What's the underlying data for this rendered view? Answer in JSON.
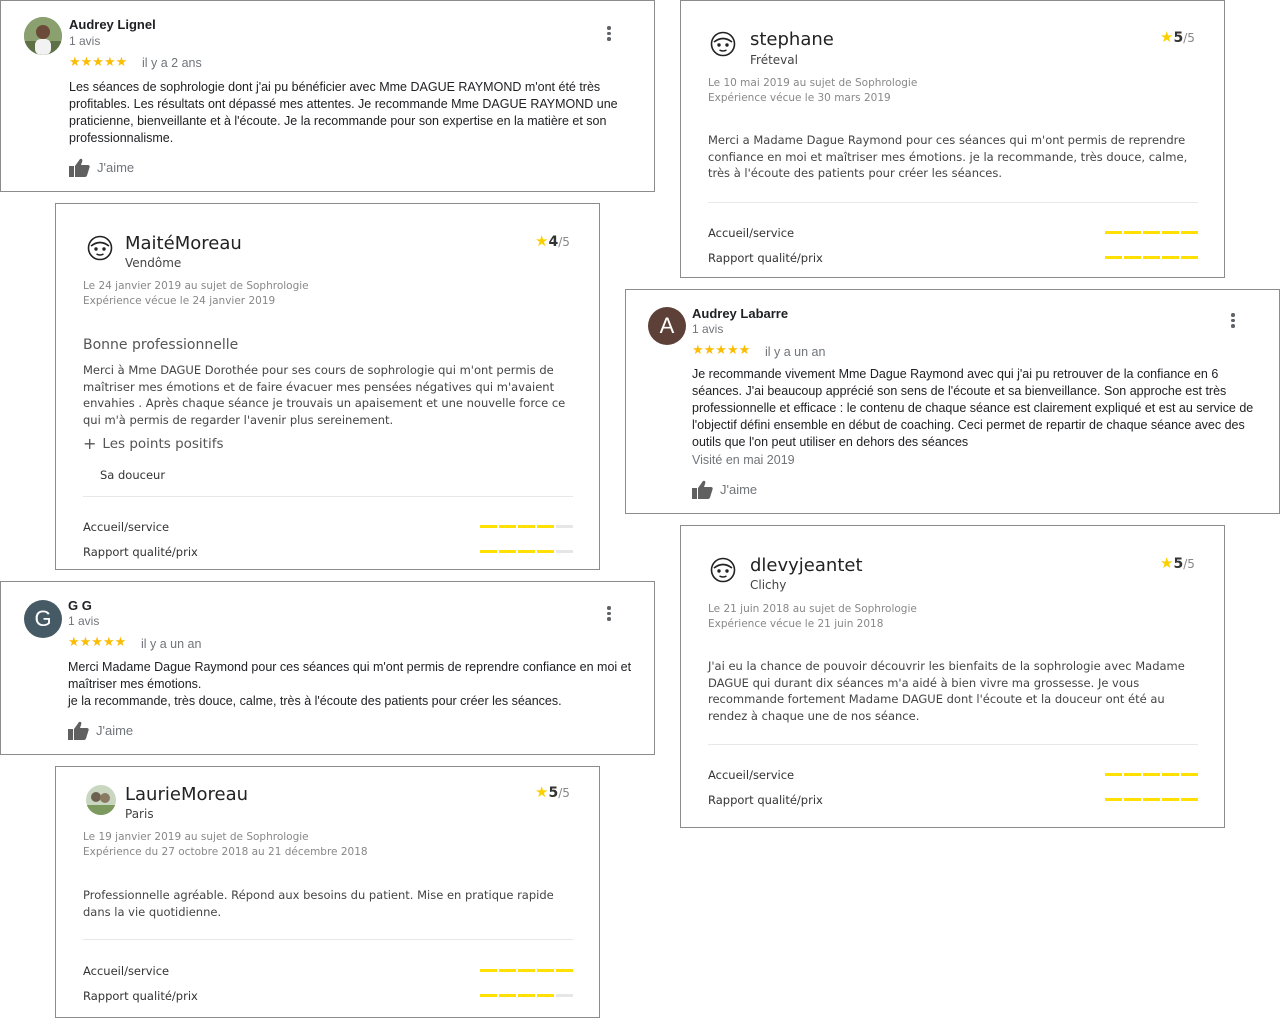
{
  "colors": {
    "star": "#fbbc04",
    "bar_on": "#ffe000",
    "bar_off": "#e6e6e6",
    "avatar_a": "#5d4037",
    "avatar_g": "#455a64"
  },
  "icons": {
    "like": "thumb-up-icon",
    "menu": "more-vert-icon",
    "anon": "anonymous-face-icon"
  },
  "google_reviews": [
    {
      "name": "Audrey Lignel",
      "count": "1 avis",
      "stars": "★★★★★",
      "date": "il y a 2 ans",
      "text": "Les séances de sophrologie dont j'ai pu bénéficier avec Mme  DAGUE RAYMOND m'ont été très profitables. Les résultats ont dépassé mes attentes. Je recommande Mme DAGUE RAYMOND une praticienne, bienveillante et à l'écoute. Je la recommande pour son expertise en la matière et son professionnalisme.",
      "like": "J'aime"
    },
    {
      "name": "Audrey Labarre",
      "initial": "A",
      "count": "1 avis",
      "stars": "★★★★★",
      "date": "il y a un an",
      "text": "Je recommande vivement Mme Dague Raymond avec qui j'ai pu retrouver de la confiance en 6 séances. J'ai beaucoup apprécié son sens de l'écoute et sa bienveillance. Son approche est très professionnelle et efficace : le contenu de chaque séance est clairement expliqué et est au service de l'objectif défini ensemble en début de coaching. Ceci permet de repartir de chaque séance avec des outils que l'on peut utiliser en dehors des séances",
      "visit": "Visité en mai 2019",
      "like": "J'aime"
    },
    {
      "name": "G G",
      "initial": "G",
      "count": "1 avis",
      "stars": "★★★★★",
      "date": "il y a un an",
      "text": "Merci Madame Dague Raymond pour ces séances qui m'ont permis de reprendre confiance en moi et maîtriser mes émotions.\nje la recommande, très douce, calme, très à l'écoute des patients pour créer les séances.",
      "like": "J'aime"
    }
  ],
  "pj_reviews": [
    {
      "name": "stephane",
      "city": "Fréteval",
      "rating": "5",
      "rating_total": "/5",
      "meta1": "Le 10 mai 2019 au sujet de Sophrologie",
      "meta2": "Expérience vécue le 30 mars 2019",
      "text": "Merci a Madame Dague Raymond pour ces séances qui m'ont permis de reprendre confiance en moi et maîtriser mes émotions. je la recommande, très douce, calme, très à l'écoute des patients pour créer les séances.",
      "accueil_label": "Accueil/service",
      "accueil_score": 5,
      "rapport_label": "Rapport qualité/prix",
      "rapport_score": 5
    },
    {
      "name": "MaitéMoreau",
      "city": "Vendôme",
      "rating": "4",
      "rating_total": "/5",
      "meta1": "Le 24 janvier 2019 au sujet de Sophrologie",
      "meta2": "Expérience vécue le 24 janvier 2019",
      "title": "Bonne professionnelle",
      "text": "Merci à Mme DAGUE Dorothée pour ses cours de sophrologie qui m'ont permis de maîtriser mes émotions et de faire évacuer mes pensées négatives qui m'avaient envahies . Après chaque séance je trouvais un apaisement et une nouvelle force ce qui m'à permis de regarder l'avenir plus sereinement.",
      "positives_label": "Les points positifs",
      "positives_text": "Sa douceur",
      "accueil_label": "Accueil/service",
      "accueil_score": 4,
      "rapport_label": "Rapport qualité/prix",
      "rapport_score": 4
    },
    {
      "name": "dlevyjeantet",
      "city": "Clichy",
      "rating": "5",
      "rating_total": "/5",
      "meta1": "Le 21 juin 2018 au sujet de Sophrologie",
      "meta2": "Expérience vécue le 21 juin 2018",
      "text": "J'ai eu la chance de pouvoir découvrir les bienfaits de la sophrologie avec Madame DAGUE qui durant dix séances m'a aidé à bien vivre ma grossesse. Je vous recommande fortement Madame DAGUE dont l'écoute et la douceur ont été au rendez à chaque une de nos séance.",
      "accueil_label": "Accueil/service",
      "accueil_score": 5,
      "rapport_label": "Rapport qualité/prix",
      "rapport_score": 5
    },
    {
      "name": "LaurieMoreau",
      "city": "Paris",
      "rating": "5",
      "rating_total": "/5",
      "meta1": "Le 19 janvier 2019 au sujet de Sophrologie",
      "meta2": "Expérience du 27 octobre 2018 au 21 décembre 2018",
      "text": "Professionnelle agréable. Répond aux besoins du patient. Mise en pratique rapide dans la vie quotidienne.",
      "accueil_label": "Accueil/service",
      "accueil_score": 5,
      "rapport_label": "Rapport qualité/prix",
      "rapport_score": 4
    }
  ]
}
